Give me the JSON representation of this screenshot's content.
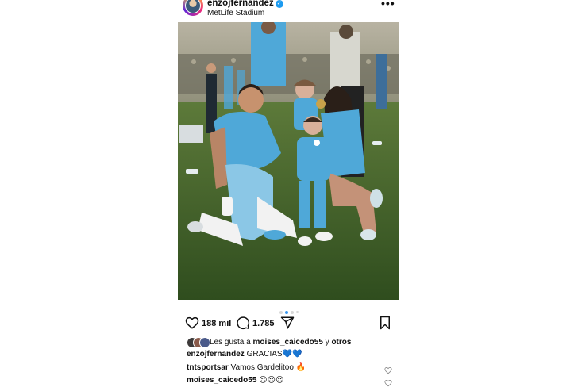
{
  "post": {
    "username": "enzojfernandez",
    "location": "MetLife Stadium",
    "more_icon": "more-dots-icon",
    "photo_icon": "photo-image"
  },
  "carousel": {
    "count": 4,
    "active_index": 1
  },
  "actions": {
    "likes_count": "188 mil",
    "comments_count": "1.785",
    "like_icon": "heart-icon",
    "comment_icon": "comment-icon",
    "share_icon": "share-icon",
    "save_icon": "bookmark-icon"
  },
  "liked_by": {
    "prefix": "Les gusta a",
    "user": "moises_caicedo55",
    "connector": "y",
    "others": "otros"
  },
  "caption": {
    "username": "enzojfernandez",
    "text": "GRACIAS💙💙"
  },
  "comments": [
    {
      "username": "tntsportsar",
      "text": "Vamos Gardelitoo 🔥"
    },
    {
      "username": "moises_caicedo55",
      "text": "😍😍😍"
    }
  ],
  "colors": {
    "verified": "#1d9bf0",
    "carousel_active": "#3897f0",
    "kit_blue": "#4fa8d8"
  }
}
